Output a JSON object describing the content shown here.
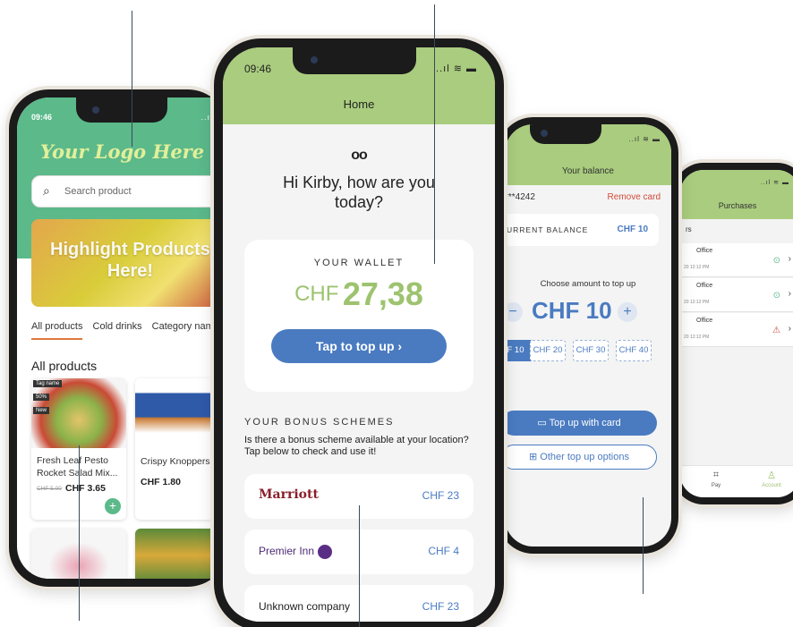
{
  "phone_left": {
    "time": "09:46",
    "status": "..ıl ≋",
    "logo": "Your Logo Here",
    "search_placeholder": "Search product",
    "banner_text": "Highlight Products Here!",
    "tabs": [
      "All products",
      "Cold drinks",
      "Category name"
    ],
    "section_title": "All products",
    "products": [
      {
        "name": "Fresh Leaf Pesto Rocket Salad Mix...",
        "old_price": "CHF 5.00",
        "price": "CHF 3.65",
        "tags": [
          "Tag name",
          "50%",
          "New"
        ]
      },
      {
        "name": "Crispy Knoppers",
        "price": "CHF 1.80"
      }
    ],
    "colors": {
      "header": "#5bb98a",
      "accent_tab": "#e0763a"
    }
  },
  "phone_center": {
    "time": "09:46",
    "status": "..ıl ≋ ▬",
    "title": "Home",
    "face": "oo",
    "greeting": "Hi Kirby, how are you today?",
    "wallet_label": "YOUR WALLET",
    "wallet_currency": "CHF",
    "wallet_amount": "27,38",
    "topup_button": "Tap to top up  ›",
    "bonus_title": "YOUR BONUS SCHEMES",
    "bonus_desc": "Is there a bonus scheme available at your location? Tap below to check and use it!",
    "brands": [
      {
        "name": "Marriott",
        "value": "CHF 23"
      },
      {
        "name": "Premier Inn",
        "value": "CHF 4"
      },
      {
        "name": "Unknown company",
        "value": "CHF 23"
      }
    ],
    "colors": {
      "header": "#a9cc7e",
      "primary": "#4a7bc1",
      "wallet": "#9dc36f"
    }
  },
  "phone_balance": {
    "status": "..ıl ≋ ▬",
    "title": "Your balance",
    "card": "***4242",
    "remove_card": "Remove card",
    "current_balance_label": "URRENT BALANCE",
    "current_balance_value": "CHF 10",
    "choose_label": "Choose amount to top up",
    "minus": "−",
    "plus": "+",
    "amount": "CHF 10",
    "chips": [
      "F 10",
      "CHF 20",
      "CHF 30",
      "CHF 40"
    ],
    "topup_card": "Top up with card",
    "other_options": "Other top up options"
  },
  "phone_purchases": {
    "status": "..ıl ≋ ▬",
    "title": "Purchases",
    "label": "rs",
    "rows": [
      {
        "title": "Office",
        "date": "20 12:12 PM",
        "status_icon": "check-circle"
      },
      {
        "title": "Office",
        "date": "20 12:12 PM",
        "status_icon": "check-circle"
      },
      {
        "title": "Office",
        "date": "20 12:12 PM",
        "status_icon": "warning"
      }
    ],
    "tabs": [
      {
        "label": "Pay",
        "icon": "qr-icon"
      },
      {
        "label": "Account",
        "icon": "user-icon"
      }
    ]
  }
}
